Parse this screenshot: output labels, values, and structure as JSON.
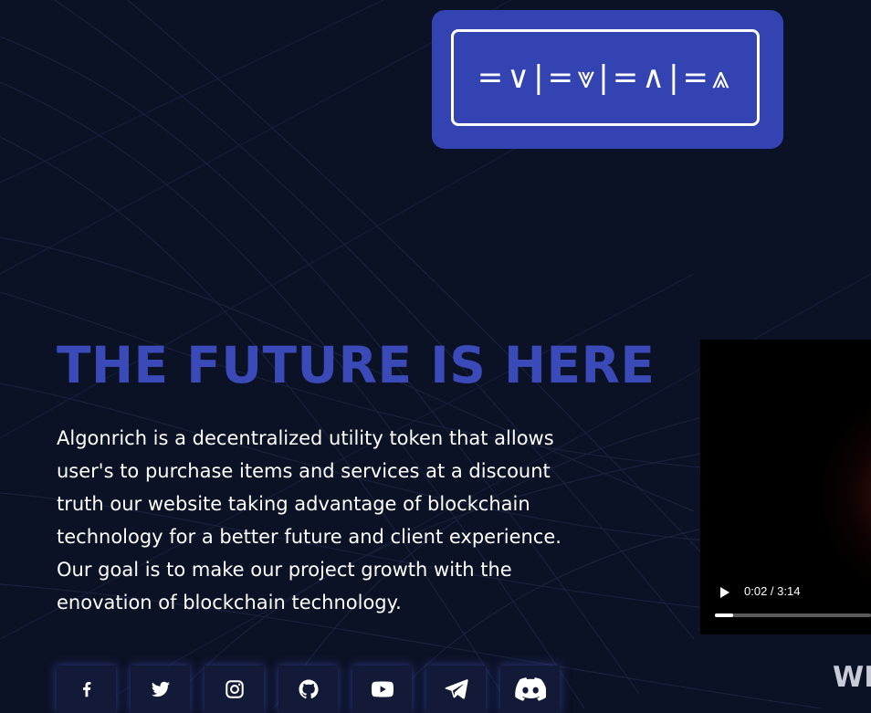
{
  "logo": {
    "text": "=∨|=⩔|=∧|=⩓"
  },
  "hero": {
    "title": "THE FUTURE IS HERE",
    "description": "Algonrich is a decentralized utility token that allows user's to purchase items and services at a discount truth our website taking advantage of blockchain technology for a better future and client experience. Our goal is to make our project growth with the enovation of blockchain technology."
  },
  "video": {
    "time": "0:02 / 3:14",
    "progress_fraction": 0.011
  },
  "socials": [
    {
      "icon": "facebook-icon"
    },
    {
      "icon": "twitter-icon"
    },
    {
      "icon": "instagram-icon"
    },
    {
      "icon": "github-icon"
    },
    {
      "icon": "youtube-icon"
    },
    {
      "icon": "telegram-icon"
    },
    {
      "icon": "discord-icon"
    }
  ],
  "next_section": {
    "heading_partial": "WH"
  },
  "colors": {
    "background": "#0c1226",
    "accent": "#3344b2",
    "title": "#3a4ab8",
    "text": "#ffffff"
  }
}
